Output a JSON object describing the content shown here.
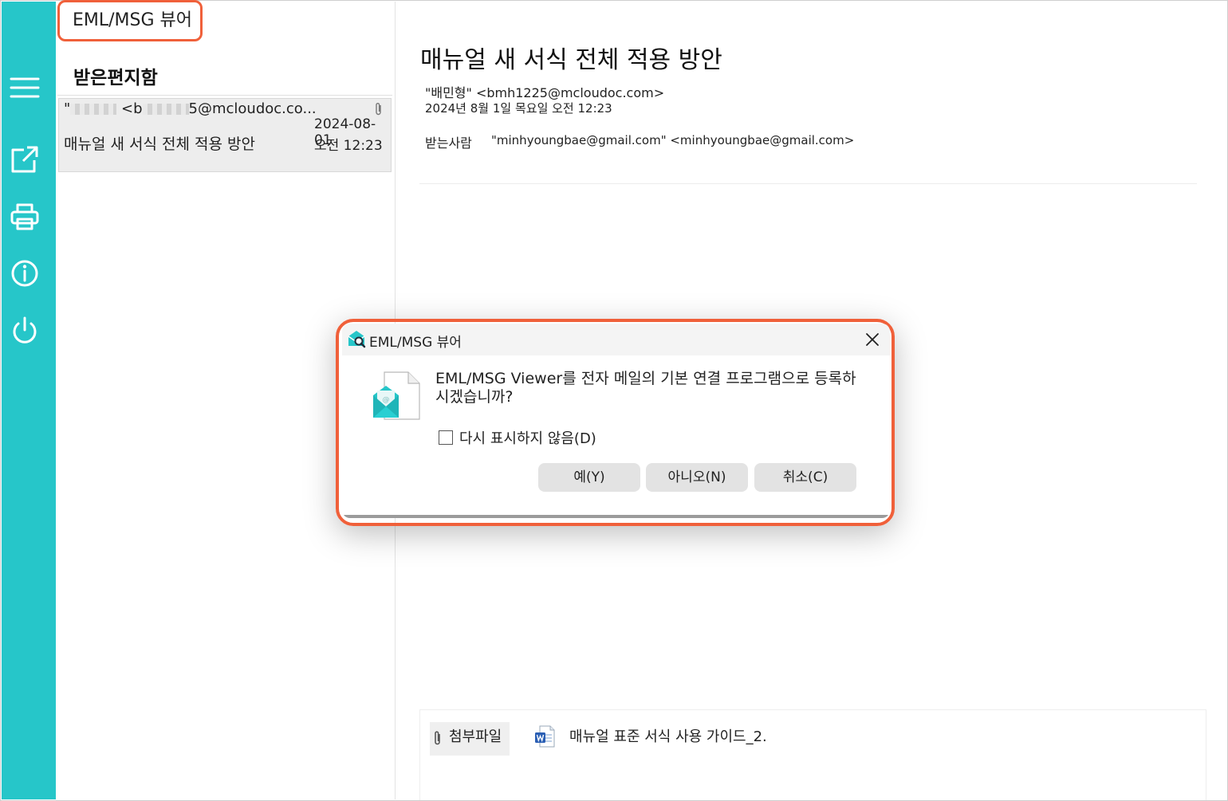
{
  "app": {
    "title": "EML/MSG 뷰어"
  },
  "colors": {
    "sidebar": "#26c6c9",
    "highlight": "#f0603a",
    "button": "#e3e3e3"
  },
  "sidebar": {
    "icons": [
      "menu-icon",
      "open-external-icon",
      "print-icon",
      "info-icon",
      "power-icon"
    ]
  },
  "list": {
    "folder_title": "받은편지함",
    "items": [
      {
        "from_prefix": "\"",
        "from_mid": "<b",
        "from_suffix": "5@mcloudoc.co...",
        "date": "2024-08-01",
        "time": "오전 12:23",
        "subject": "매뉴얼 새 서식 전체 적용 방안",
        "has_attachment": true
      }
    ]
  },
  "message": {
    "subject": "매뉴얼 새 서식 전체 적용 방안",
    "from": "\"배민형\" <bmh1225@mcloudoc.com>",
    "date": "2024년 8월 1일 목요일 오전 12:23",
    "to_label": "받는사람",
    "to_value": "\"minhyoungbae@gmail.com\" <minhyoungbae@gmail.com>",
    "attachments_label": "첨부파일",
    "attachment_file": "매뉴얼 표준 서식 사용 가이드_2."
  },
  "dialog": {
    "title": "EML/MSG 뷰어",
    "message": "EML/MSG Viewer를 전자 메일의 기본 연결 프로그램으로 등록하시겠습니까?",
    "checkbox_label": "다시 표시하지 않음(D)",
    "checkbox_checked": false,
    "yes_label": "예(Y)",
    "no_label": "아니오(N)",
    "cancel_label": "취소(C)"
  }
}
